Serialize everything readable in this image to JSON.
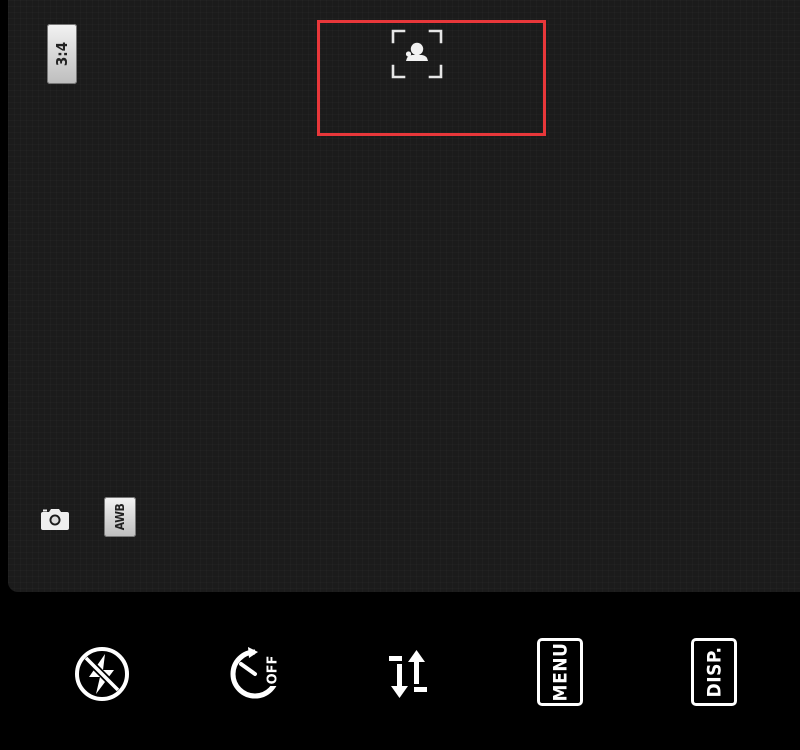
{
  "viewfinder": {
    "aspect_ratio_label": "3:4",
    "white_balance_label": "AWB",
    "mode_icon": "camera-icon",
    "focus_icon": "face-detect-icon",
    "focus_box_color": "#e8373a"
  },
  "controls": {
    "flash_icon": "flash-off-icon",
    "timer_icon": "self-timer-off-icon",
    "timer_label": "OFF",
    "sort_icon": "swap-vertical-icon",
    "menu_label": "MENU",
    "display_label": "DISP."
  }
}
